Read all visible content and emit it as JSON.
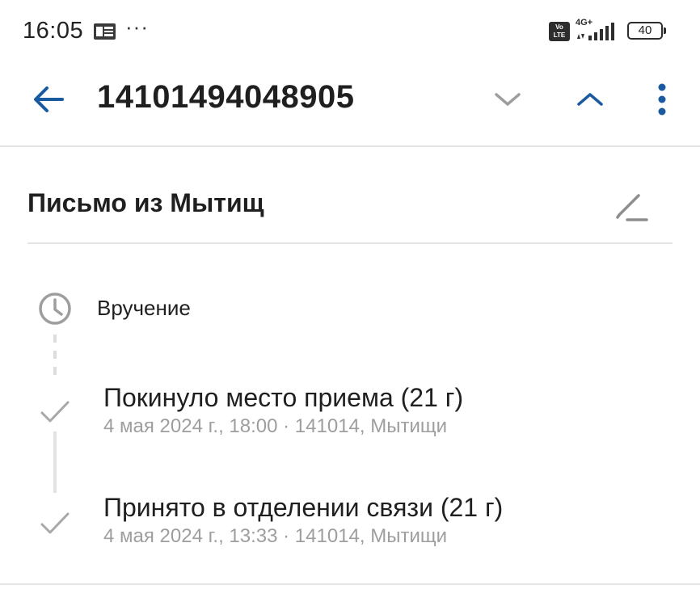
{
  "status_bar": {
    "time": "16:05",
    "app_icon": "office-icon",
    "overflow_dots": "···",
    "volte": "Vo LTE",
    "network_type": "4G+",
    "battery_level": "40"
  },
  "app_bar": {
    "tracking_number": "14101494048905",
    "icons": {
      "back": "arrow-left-icon",
      "next": "chevron-down-icon",
      "previous": "chevron-up-icon",
      "more": "more-vertical-icon"
    },
    "accent_color": "#1a5aa0"
  },
  "parcel": {
    "name": "Письмо из Мытищ",
    "edit_icon": "pencil-icon"
  },
  "timeline": {
    "pending": {
      "icon": "clock-icon",
      "label": "Вручение"
    },
    "events": [
      {
        "title": "Покинуло место приема (21 г)",
        "subtitle": "4 мая 2024 г., 18:00 · 141014, Мытищи",
        "icon": "check-icon"
      },
      {
        "title": "Принято в отделении связи (21 г)",
        "subtitle": "4 мая 2024 г., 13:33 · 141014, Мытищи",
        "icon": "check-icon"
      }
    ]
  }
}
